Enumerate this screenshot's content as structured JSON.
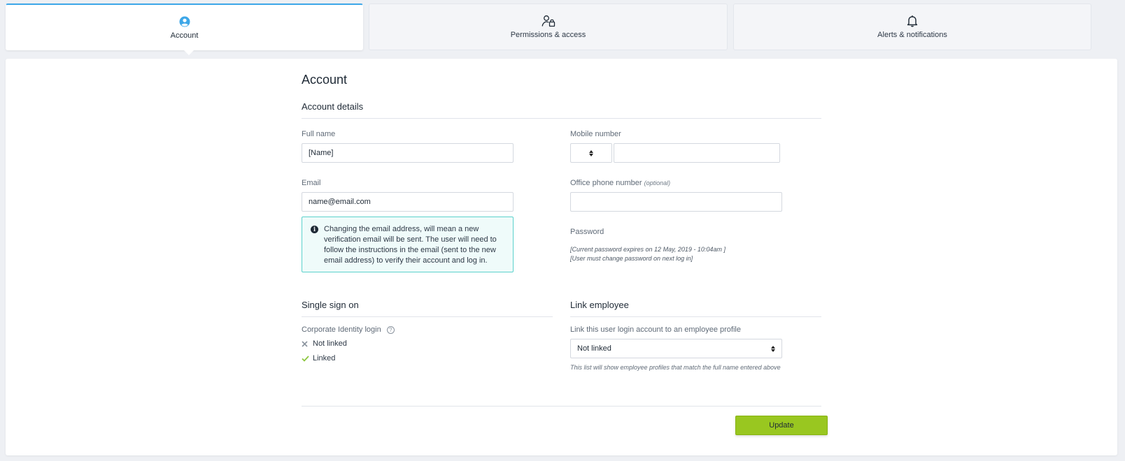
{
  "tabs": [
    {
      "label": "Account",
      "icon": "user-circle-icon",
      "active": true
    },
    {
      "label": "Permissions & access",
      "icon": "user-lock-icon",
      "active": false
    },
    {
      "label": "Alerts & notifications",
      "icon": "bell-icon",
      "active": false
    }
  ],
  "page": {
    "title": "Account"
  },
  "account_details": {
    "heading": "Account details",
    "full_name": {
      "label": "Full name",
      "value": "[Name]"
    },
    "email": {
      "label": "Email",
      "value": "name@email.com"
    },
    "email_notice": "Changing the email address, will mean a new verification email will be sent. The user will need to follow the instructions in the email (sent to the new email address) to verify their account and log in.",
    "mobile": {
      "label": "Mobile number",
      "country_code": "",
      "value": ""
    },
    "office_phone": {
      "label": "Office phone number",
      "optional": "(optional)",
      "value": ""
    },
    "password": {
      "label": "Password",
      "expiry_note": "[Current password expires on 12 May, 2019 - 10:04am ]",
      "change_note": "[User must change password on next log in]"
    }
  },
  "sso": {
    "heading": "Single sign on",
    "label": "Corporate Identity login",
    "help_icon": "question-circle-icon",
    "options": [
      {
        "label": "Not linked",
        "icon": "cross-icon",
        "color": "#8a939e"
      },
      {
        "label": "Linked",
        "icon": "check-icon",
        "color": "#8cc63f"
      }
    ]
  },
  "link_employee": {
    "heading": "Link employee",
    "label": "Link this user login account to an employee profile",
    "selected": "Not linked",
    "helper": "This list will show employee profiles that match the full name entered above"
  },
  "actions": {
    "update_label": "Update"
  },
  "colors": {
    "accent": "#3da7e8",
    "primary_button": "#99c720",
    "info_border": "#5cd2cc",
    "info_bg": "#effbfa"
  }
}
